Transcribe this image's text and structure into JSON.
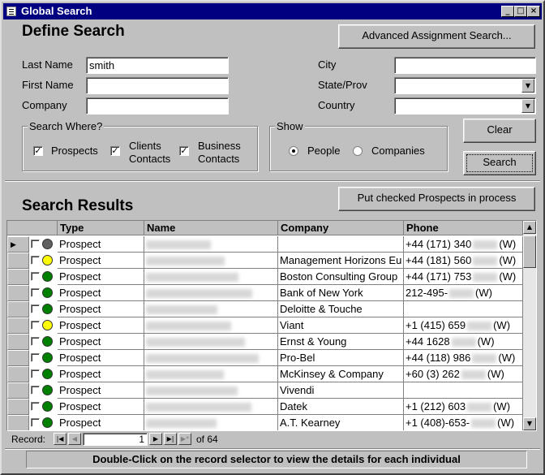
{
  "window": {
    "title": "Global Search"
  },
  "define": {
    "heading": "Define Search",
    "advanced_label": "Advanced Assignment Search...",
    "last_name_label": "Last Name",
    "last_name_value": "smith",
    "first_name_label": "First Name",
    "first_name_value": "",
    "company_label": "Company",
    "company_value": "",
    "city_label": "City",
    "city_value": "",
    "state_label": "State/Prov",
    "state_value": "",
    "country_label": "Country",
    "country_value": ""
  },
  "search_where": {
    "label": "Search Where?",
    "prospects_label": "Prospects",
    "clients_label_1": "Clients",
    "clients_label_2": "Contacts",
    "business_label_1": "Business",
    "business_label_2": "Contacts"
  },
  "show": {
    "label": "Show",
    "people_label": "People",
    "companies_label": "Companies",
    "selected": "People"
  },
  "buttons": {
    "clear": "Clear",
    "search": "Search",
    "put_checked": "Put checked Prospects in process"
  },
  "results": {
    "heading": "Search Results",
    "columns": [
      "Type",
      "Name",
      "Company",
      "Phone"
    ],
    "rows": [
      {
        "type": "Prospect",
        "status": "gray",
        "company": "",
        "phone": "+44 (171) 340",
        "phone_suffix": "(W)"
      },
      {
        "type": "Prospect",
        "status": "yellow",
        "company": "Management Horizons Eu",
        "phone": "+44 (181) 560",
        "phone_suffix": "(W)"
      },
      {
        "type": "Prospect",
        "status": "green",
        "company": "Boston Consulting Group",
        "phone": "+44 (171) 753",
        "phone_suffix": "(W)"
      },
      {
        "type": "Prospect",
        "status": "green",
        "company": "Bank of New York",
        "phone": "212-495-",
        "phone_suffix": "(W)"
      },
      {
        "type": "Prospect",
        "status": "green",
        "company": "Deloitte & Touche",
        "phone": "",
        "phone_suffix": ""
      },
      {
        "type": "Prospect",
        "status": "yellow",
        "company": "Viant",
        "phone": "+1 (415) 659",
        "phone_suffix": "(W)"
      },
      {
        "type": "Prospect",
        "status": "green",
        "company": "Ernst & Young",
        "phone": "+44 1628",
        "phone_suffix": "(W)"
      },
      {
        "type": "Prospect",
        "status": "green",
        "company": "Pro-Bel",
        "phone": "+44 (118) 986",
        "phone_suffix": "(W)"
      },
      {
        "type": "Prospect",
        "status": "green",
        "company": "McKinsey & Company",
        "phone": "+60 (3) 262",
        "phone_suffix": "(W)"
      },
      {
        "type": "Prospect",
        "status": "green",
        "company": "Vivendi",
        "phone": "",
        "phone_suffix": ""
      },
      {
        "type": "Prospect",
        "status": "green",
        "company": "Datek",
        "phone": "+1 (212) 603",
        "phone_suffix": "(W)"
      },
      {
        "type": "Prospect",
        "status": "green",
        "company": "A.T. Kearney",
        "phone": "+1 (408)-653-",
        "phone_suffix": "(W)"
      }
    ]
  },
  "record_nav": {
    "label": "Record:",
    "current": "1",
    "of_label": "of 64"
  },
  "status_bar": {
    "text": "Double-Click on the record selector to view the details for each individual"
  },
  "colors": {
    "title_bg": "#000080",
    "gray": "#606060",
    "yellow": "#ffff00",
    "green": "#008000"
  }
}
